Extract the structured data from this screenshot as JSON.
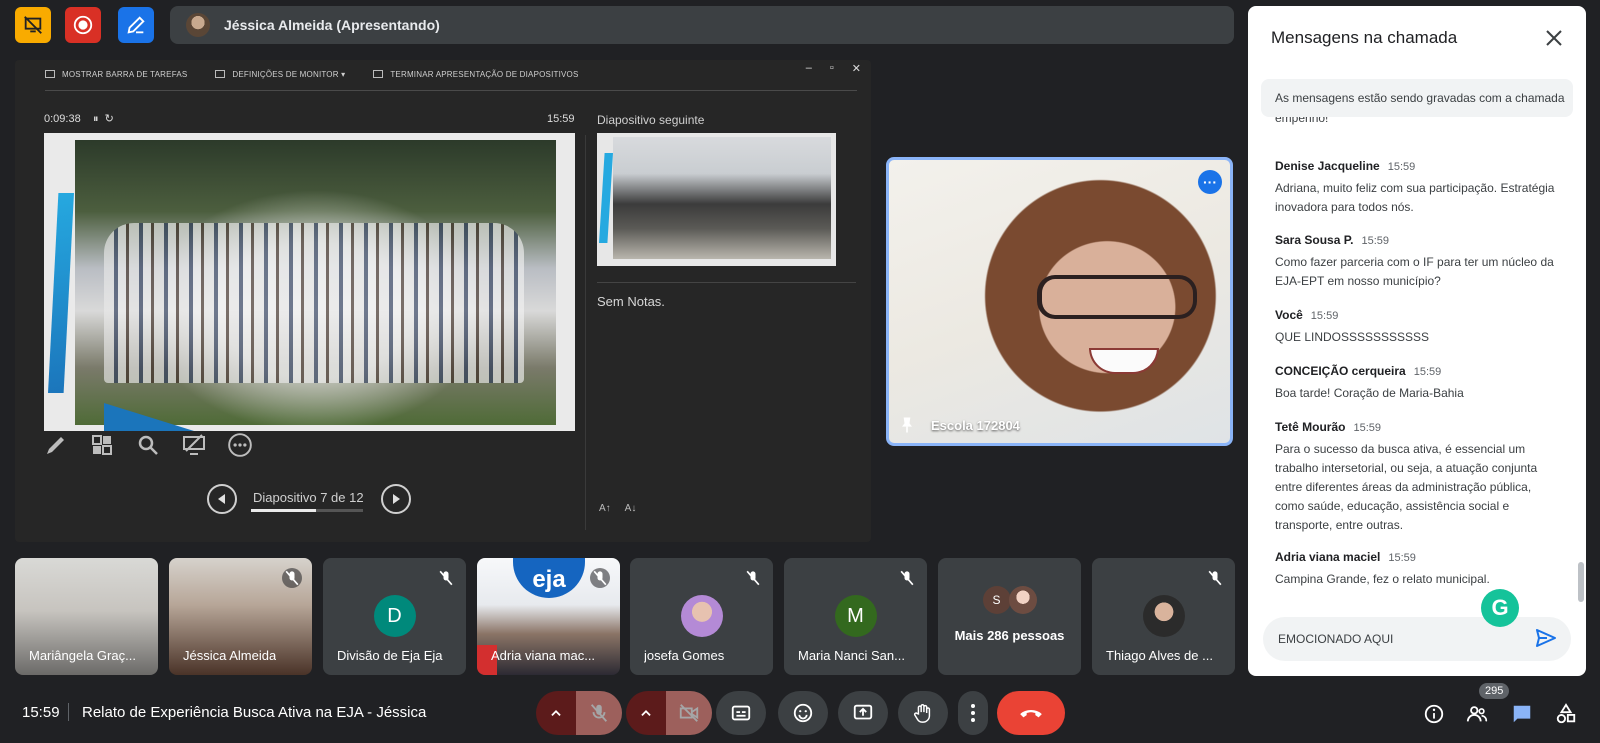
{
  "presenter": {
    "name": "Jéssica Almeida (Apresentando)"
  },
  "slideshow": {
    "toolbar": [
      "MOSTRAR BARRA DE TAREFAS",
      "DEFINIÇÕES DE MONITOR ▾",
      "TERMINAR APRESENTAÇÃO DE DIAPOSITIVOS"
    ],
    "timer": "0:09:38",
    "clock": "15:59",
    "next_label": "Diapositivo seguinte",
    "notes": "Sem Notas.",
    "slide_counter": "Diapositivo 7 de 12",
    "progress": 0.5833
  },
  "featured": {
    "name": "Escola 172804"
  },
  "tiles": [
    {
      "name": "Mariângela Graç..."
    },
    {
      "name": "Jéssica Almeida"
    },
    {
      "name": "Divisão de Eja Eja",
      "initial": "D",
      "color": "#00897b"
    },
    {
      "name": "Adria viana mac...",
      "logo": "eja"
    },
    {
      "name": "josefa Gomes"
    },
    {
      "name": "Maria Nanci San...",
      "initial": "M",
      "color": "#33691e"
    },
    {
      "name": "Mais 286 pessoas",
      "initial": "S"
    },
    {
      "name": "Thiago Alves de ..."
    }
  ],
  "chat": {
    "title": "Mensagens na chamada",
    "notice": "As mensagens estão sendo gravadas com a chamada",
    "cut_text": "empenho!",
    "messages": [
      {
        "sender": "Denise Jacqueline",
        "time": "15:59",
        "text": "Adriana, muito feliz com sua participação. Estratégia inovadora para todos nós."
      },
      {
        "sender": "Sara Sousa P.",
        "time": "15:59",
        "text": "Como fazer parceria com o  IF para ter um núcleo da EJA-EPT em nosso município?"
      },
      {
        "sender": "Você",
        "time": "15:59",
        "text": "QUE LINDOSSSSSSSSSSS"
      },
      {
        "sender": "CONCEIÇÃO cerqueira",
        "time": "15:59",
        "text": "Boa tarde! Coração de Maria-Bahia"
      },
      {
        "sender": "Tetê Mourão",
        "time": "15:59",
        "text": "Para o sucesso da busca ativa, é essencial um trabalho intersetorial, ou seja, a atuação conjunta entre diferentes áreas da administração pública, como saúde, educação, assistência social e transporte, entre outras."
      },
      {
        "sender": "Adria viana maciel",
        "time": "15:59",
        "text": "Campina Grande, fez o relato municipal."
      }
    ],
    "input_value": "EMOCIONADO AQUI"
  },
  "bottom": {
    "time": "15:59",
    "meeting_title": "Relato de Experiência Busca Ativa na EJA - Jéssica",
    "participant_count": "295"
  }
}
